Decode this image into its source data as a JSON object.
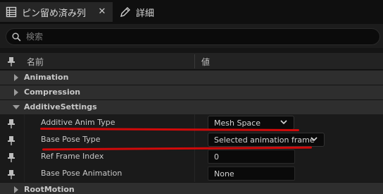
{
  "tabs": [
    {
      "label": "ピン留め済み列",
      "icon": "grid-icon",
      "active": true
    },
    {
      "label": "詳細",
      "icon": "pencil-icon",
      "active": false
    }
  ],
  "tab_close_glyph": "✕",
  "search": {
    "placeholder": "検索",
    "value": ""
  },
  "columns": {
    "name": "名前",
    "value": "値"
  },
  "categories": {
    "animation": "Animation",
    "compression": "Compression",
    "additive": "AdditiveSettings",
    "rootmotion": "RootMotion"
  },
  "properties": [
    {
      "label": "Additive Anim Type",
      "value": "Mesh Space",
      "kind": "dropdown"
    },
    {
      "label": "Base Pose Type",
      "value": "Selected animation frame",
      "kind": "dropdown"
    },
    {
      "label": "Ref Frame Index",
      "value": "0",
      "kind": "number"
    },
    {
      "label": "Base Pose Animation",
      "value": "None",
      "kind": "asset"
    }
  ],
  "colors": {
    "annotation_underline": "#d10a0a",
    "panel_bg": "#151515"
  }
}
